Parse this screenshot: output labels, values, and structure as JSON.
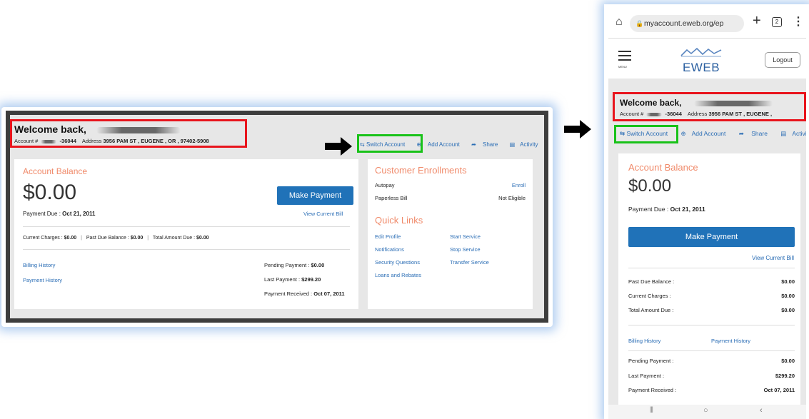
{
  "desktop": {
    "welcome": "Welcome back,",
    "account_label": "Account #",
    "account_suffix": "-36044",
    "address_label": "Address",
    "address": "3956 PAM ST , EUGENE , OR , 97402-5908",
    "actions": {
      "switch_account": "Switch Account",
      "add_account": "Add Account",
      "share": "Share",
      "activity": "Activity"
    },
    "balance": {
      "title": "Account Balance",
      "amount": "$0.00",
      "make_payment": "Make Payment",
      "payment_due_label": "Payment Due :",
      "payment_due": "Oct 21, 2011",
      "view_current_bill": "View Current Bill",
      "current_charges_label": "Current Charges :",
      "current_charges": "$0.00",
      "past_due_label": "Past Due Balance :",
      "past_due": "$0.00",
      "total_due_label": "Total Amount Due :",
      "total_due": "$0.00",
      "billing_history": "Billing History",
      "payment_history": "Payment History",
      "pending_label": "Pending Payment :",
      "pending": "$0.00",
      "last_label": "Last Payment :",
      "last": "$299.20",
      "received_label": "Payment Received :",
      "received": "Oct 07, 2011"
    },
    "enrollments": {
      "title": "Customer Enrollments",
      "autopay": "Autopay",
      "autopay_action": "Enroll",
      "paperless": "Paperless Bill",
      "paperless_status": "Not Eligible"
    },
    "quick_links": {
      "title": "Quick Links",
      "edit_profile": "Edit Profile",
      "notifications": "Notifications",
      "security_questions": "Security Questions",
      "loans_rebates": "Loans and Rebates",
      "start_service": "Start Service",
      "stop_service": "Stop Service",
      "transfer_service": "Transfer Service"
    }
  },
  "mobile": {
    "url": "myaccount.eweb.org/ep",
    "tab_count": "2",
    "menu_label": "MENU",
    "logo": "EWEB",
    "logout": "Logout",
    "welcome": "Welcome back,",
    "account_label": "Account #",
    "account_suffix": "-36044",
    "address_label": "Address",
    "address": "3956 PAM ST , EUGENE ,",
    "actions": {
      "switch_account": "Switch Account",
      "add_account": "Add Account",
      "share": "Share",
      "activity": "Activity"
    },
    "balance": {
      "title": "Account Balance",
      "amount": "$0.00",
      "payment_due_label": "Payment Due :",
      "payment_due": "Oct 21, 2011",
      "make_payment": "Make Payment",
      "view_current_bill": "View Current Bill",
      "past_due_label": "Past Due Balance :",
      "past_due": "$0.00",
      "current_charges_label": "Current Charges :",
      "current_charges": "$0.00",
      "total_due_label": "Total Amount Due :",
      "total_due": "$0.00",
      "billing_history": "Billing History",
      "payment_history": "Payment History",
      "pending_label": "Pending Payment :",
      "pending": "$0.00",
      "last_label": "Last Payment :",
      "last": "$299.20",
      "received_label": "Payment Received :",
      "received": "Oct 07, 2011"
    }
  },
  "colors": {
    "highlight_red": "#e8141c",
    "highlight_green": "#19c219",
    "accent_blue": "#2072b8",
    "title_orange": "#f08a6a"
  }
}
